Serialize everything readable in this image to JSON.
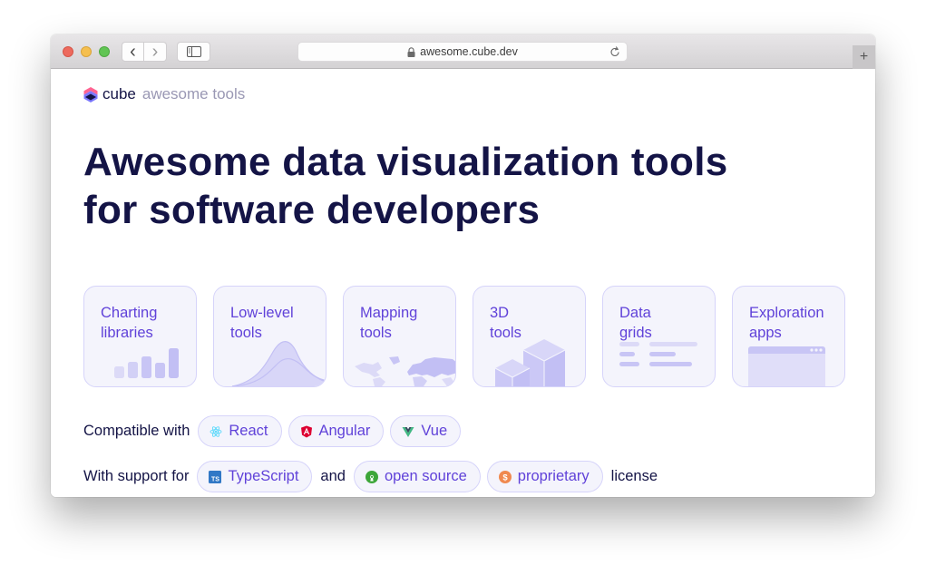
{
  "browser": {
    "url": "awesome.cube.dev",
    "new_tab_glyph": "+",
    "back_glyph": "‹",
    "forward_glyph": "›"
  },
  "brand": {
    "name": "cube",
    "suffix": "awesome tools"
  },
  "headline": {
    "line1": "Awesome data visualization tools",
    "line2": "for software developers"
  },
  "categories": [
    {
      "label": "Charting\nlibraries",
      "icon": "bar-chart-icon"
    },
    {
      "label": "Low-level\ntools",
      "icon": "distribution-curve-icon"
    },
    {
      "label": "Mapping\ntools",
      "icon": "world-map-icon"
    },
    {
      "label": "3D\ntools",
      "icon": "cubes-icon"
    },
    {
      "label": "Data\ngrids",
      "icon": "grid-rows-icon"
    },
    {
      "label": "Exploration\napps",
      "icon": "app-window-icon"
    }
  ],
  "compatible": {
    "prefix": "Compatible with",
    "frameworks": [
      {
        "label": "React",
        "icon": "react-icon",
        "color": "#61dafb"
      },
      {
        "label": "Angular",
        "icon": "angular-icon",
        "color": "#dd0031"
      },
      {
        "label": "Vue",
        "icon": "vue-icon",
        "color": "#41b883"
      }
    ]
  },
  "support": {
    "prefix": "With support for",
    "typescript": {
      "label": "TypeScript",
      "icon": "typescript-icon",
      "color": "#3178c6"
    },
    "conjunction": "and",
    "licenses": [
      {
        "label": "open source",
        "icon": "open-source-icon",
        "color": "#3da639"
      },
      {
        "label": "proprietary",
        "icon": "dollar-icon",
        "color": "#f0894f"
      }
    ],
    "suffix": "license"
  },
  "colors": {
    "accent": "#6042d9",
    "heading": "#141446",
    "chip_bg": "#f4f4fc",
    "chip_border": "#d6d4fa"
  }
}
